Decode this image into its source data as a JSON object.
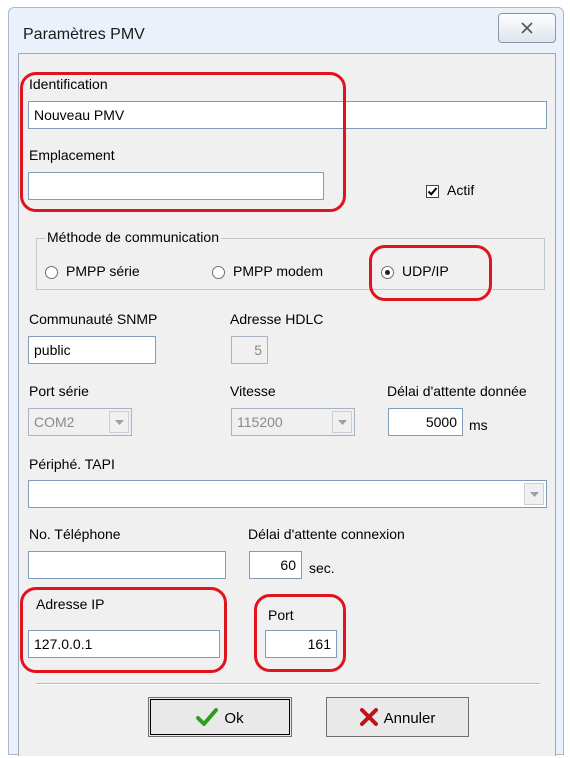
{
  "window": {
    "title": "Paramètres PMV",
    "close_icon": "close-x-icon"
  },
  "identification": {
    "label": "Identification",
    "value": "Nouveau PMV"
  },
  "emplacement": {
    "label": "Emplacement",
    "value": ""
  },
  "actif": {
    "label": "Actif",
    "checked": true
  },
  "communication": {
    "group_label": "Méthode de communication",
    "options": [
      {
        "label": "PMPP série",
        "selected": false
      },
      {
        "label": "PMPP modem",
        "selected": false
      },
      {
        "label": "UDP/IP",
        "selected": true
      }
    ]
  },
  "snmp": {
    "label": "Communauté SNMP",
    "value": "public"
  },
  "hdlc": {
    "label": "Adresse HDLC",
    "value": "5"
  },
  "port_serie": {
    "label": "Port série",
    "value": "COM2"
  },
  "vitesse": {
    "label": "Vitesse",
    "value": "115200"
  },
  "delai_donnee": {
    "label": "Délai d'attente donnée",
    "value": "5000",
    "unit": "ms"
  },
  "tapi": {
    "label": "Périphé. TAPI",
    "value": ""
  },
  "telephone": {
    "label": "No. Téléphone",
    "value": ""
  },
  "delai_connexion": {
    "label": "Délai d'attente connexion",
    "value": "60",
    "unit": "sec."
  },
  "adresse_ip": {
    "label": "Adresse IP",
    "value": "127.0.0.1"
  },
  "port": {
    "label": "Port",
    "value": "161"
  },
  "buttons": {
    "ok": "Ok",
    "cancel": "Annuler"
  },
  "colors": {
    "highlight": "#e0141e",
    "ok_check": "#2e9e1f",
    "cancel_x": "#c0121b"
  }
}
